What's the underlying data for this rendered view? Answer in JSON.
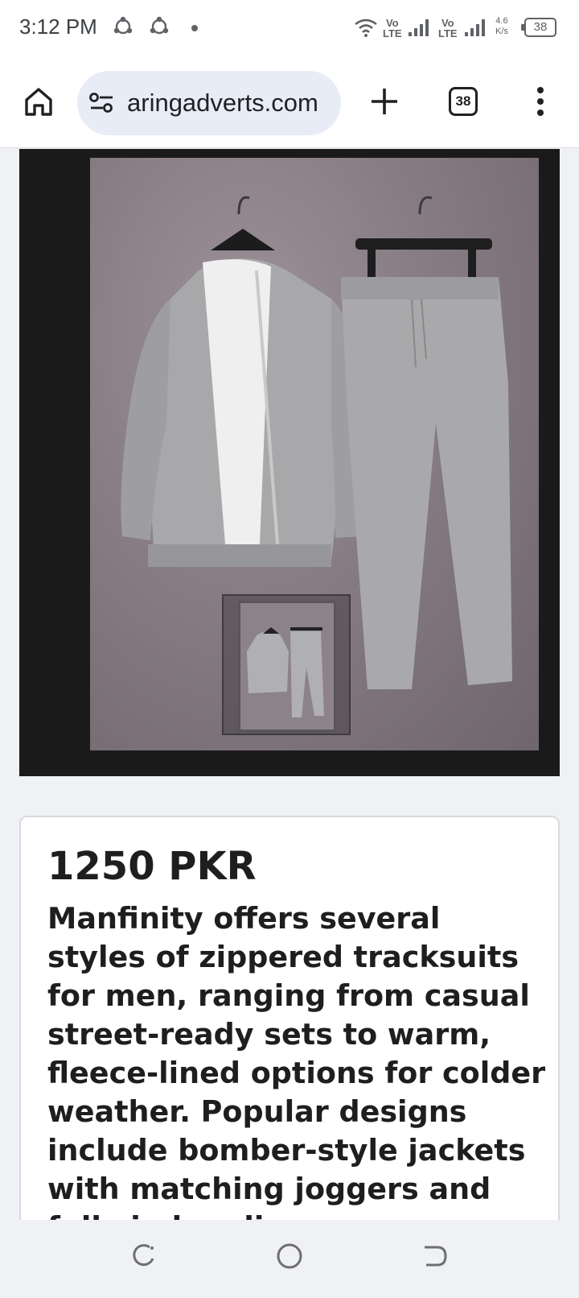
{
  "status_bar": {
    "time": "3:12 PM",
    "network_1": "Vo\nLTE",
    "network_2": "Vo\nLTE",
    "speed": "4.6\nK/s",
    "battery": "38"
  },
  "browser": {
    "url": "aringadverts.com",
    "tab_count": "38"
  },
  "product": {
    "price": "1250 PKR",
    "description": "Manfinity offers several styles of zippered tracksuits for men, ranging from casual street-ready sets to warm, fleece-lined options for colder weather. Popular designs include bomber-style jackets with matching joggers and full-zip hoodie"
  },
  "icons": {
    "home": "home-icon",
    "site_settings": "tune-icon",
    "new_tab": "plus-icon",
    "menu": "more-vert-icon",
    "recents": "recents-icon",
    "nav_home": "circle-home-icon",
    "back": "back-icon"
  },
  "colors": {
    "toolbar_bg": "#ffffff",
    "omnibox_bg": "#e8ecf6",
    "page_bg": "#eff1f5",
    "text": "#1e1e1e"
  }
}
